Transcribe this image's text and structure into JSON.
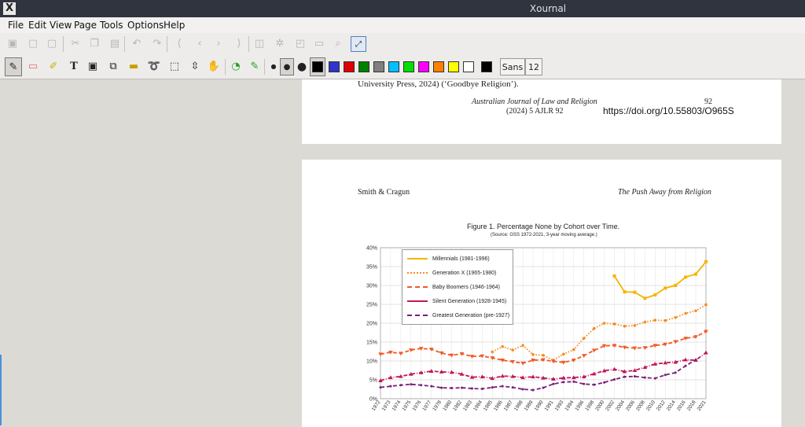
{
  "window": {
    "title": "Xournal",
    "app_icon": "X"
  },
  "menu": [
    "File",
    "Edit",
    "View",
    "Page",
    "Tools",
    "Options",
    "Help"
  ],
  "toolbar_main_icons": [
    "save-icon",
    "new-icon",
    "open-icon",
    "cut-icon",
    "copy-icon",
    "paste-icon",
    "undo-icon",
    "redo-icon",
    "first-page-icon",
    "prev-page-icon",
    "next-page-icon",
    "last-page-icon",
    "layer-icon",
    "zoom-fit-icon",
    "zoom-icon",
    "zoom-width-icon",
    "zoom-in-icon",
    "fullscreen-icon"
  ],
  "toolbar_tools": {
    "pen_label": "✎",
    "eraser_label": "▭",
    "highlighter_label": "✐",
    "text_label": "T",
    "font_name": "Sans",
    "font_size": "12",
    "colors": [
      "#000000",
      "#3333cc",
      "#e00000",
      "#008000",
      "#808080",
      "#00c0ff",
      "#00e000",
      "#ff00ff",
      "#ff8000",
      "#ffff00",
      "#ffffff",
      "#000000"
    ]
  },
  "page1": {
    "ref_line": "University Press, 2024) (‘Goodbye Religion’).",
    "journal": "Australian Journal of Law and Religion",
    "page_number": "92",
    "citation": "(2024) 5 AJLR 92",
    "doi": "https://doi.org/10.55803/O965S"
  },
  "page2": {
    "header_left": "Smith & Cragun",
    "header_right": "The Push Away from Religion"
  },
  "chart_data": {
    "type": "line",
    "title": "Figure 1. Percentage None by Cohort over Time.",
    "subtitle": "(Source: GSS 1972-2021, 3-year moving average.)",
    "y_ticks": [
      "0%",
      "5%",
      "10%",
      "15%",
      "20%",
      "25%",
      "30%",
      "35%",
      "40%"
    ],
    "ylim": [
      0,
      40
    ],
    "x_ticks": [
      "1972",
      "1973",
      "1974",
      "1975",
      "1976",
      "1977",
      "1978",
      "1980",
      "1982",
      "1983",
      "1984",
      "1985",
      "1986",
      "1987",
      "1988",
      "1989",
      "1990",
      "1991",
      "1993",
      "1994",
      "1996",
      "1998",
      "2000",
      "2002",
      "2004",
      "2006",
      "2008",
      "2010",
      "2012",
      "2014",
      "2016",
      "2018",
      "2021"
    ],
    "legend_position": "top-left",
    "series": [
      {
        "name": "Millennials (1981-1996)",
        "color": "#f5b400",
        "style": "solid",
        "start": 23,
        "values": [
          32.5,
          28.3,
          28.2,
          26.6,
          27.5,
          29.3,
          30.0,
          32.2,
          33.0,
          36.3
        ]
      },
      {
        "name": "Generation X (1965-1980)",
        "color": "#f58b1f",
        "style": "dot",
        "start": 11,
        "values": [
          12.4,
          13.8,
          12.9,
          14.1,
          11.7,
          11.5,
          10.2,
          11.8,
          13.0,
          16.0,
          18.6,
          20.0,
          19.8,
          19.2,
          19.4,
          20.3,
          20.8,
          20.7,
          21.5,
          22.6,
          23.3,
          24.9
        ]
      },
      {
        "name": "Baby Boomers (1946-1964)",
        "color": "#f05a28",
        "style": "dash",
        "start": 0,
        "values": [
          11.8,
          12.3,
          12.0,
          12.9,
          13.3,
          13.1,
          12.1,
          11.5,
          11.9,
          11.2,
          11.3,
          10.8,
          10.2,
          9.8,
          9.4,
          10.2,
          10.3,
          9.9,
          9.6,
          10.2,
          11.4,
          12.8,
          14.0,
          14.1,
          13.6,
          13.4,
          13.5,
          14.1,
          14.4,
          15.1,
          16.0,
          16.4,
          17.8
        ]
      },
      {
        "name": "Silent Generation (1928-1945)",
        "color": "#c0185a",
        "style": "dashdot",
        "start": 0,
        "values": [
          4.8,
          5.6,
          5.9,
          6.5,
          6.9,
          7.3,
          7.1,
          7.0,
          6.5,
          5.7,
          5.8,
          5.4,
          6.0,
          5.9,
          5.6,
          5.8,
          5.5,
          5.2,
          5.5,
          5.6,
          5.8,
          6.6,
          7.4,
          7.8,
          7.2,
          7.5,
          8.3,
          9.2,
          9.5,
          9.7,
          10.3,
          10.2,
          12.2
        ]
      },
      {
        "name": "Greatest Generation (pre-1927)",
        "color": "#7a1e78",
        "style": "dash",
        "start": 0,
        "values": [
          3.0,
          3.3,
          3.6,
          3.8,
          3.6,
          3.3,
          2.9,
          2.8,
          2.9,
          2.7,
          2.6,
          3.0,
          3.3,
          3.0,
          2.5,
          2.3,
          2.9,
          3.9,
          4.4,
          4.5,
          3.9,
          3.7,
          4.3,
          5.1,
          5.8,
          5.9,
          5.6,
          5.4,
          6.3,
          6.9,
          8.7,
          10.3,
          null
        ]
      }
    ]
  }
}
